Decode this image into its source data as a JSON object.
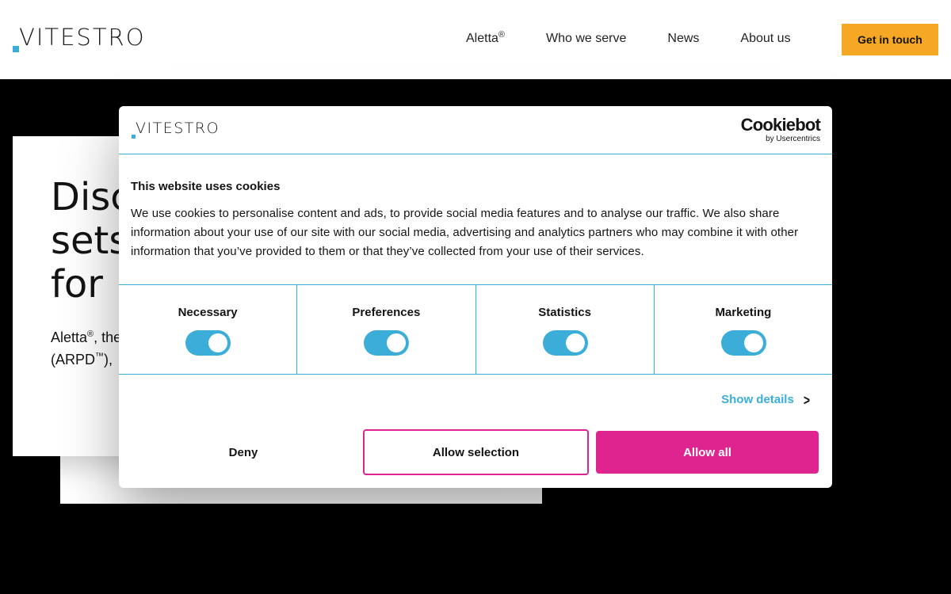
{
  "header": {
    "logo_text": "VITESTRO",
    "nav": {
      "aletta": "Aletta",
      "aletta_mark": "®",
      "who_we_serve": "Who we serve",
      "news": "News",
      "about_us": "About us"
    },
    "cta": "Get in touch"
  },
  "hero": {
    "title_line1": "Disc",
    "title_line2": "sets",
    "title_line3": "for",
    "line1_a": "Aletta",
    "line1_sup": "®",
    "line1_b": ", the",
    "line2_a": "(ARPD",
    "line2_sup": "™",
    "line2_b": "),"
  },
  "cookie": {
    "logo_text": "VITESTRO",
    "brand": "Cookiebot",
    "brand_sub": "by Usercentrics",
    "title": "This website uses cookies",
    "text": "We use cookies to personalise content and ads, to provide social media features and to analyse our traffic. We also share information about your use of our site with our social media, advertising and analytics partners who may combine it with other information that you’ve provided to them or that they’ve collected from your use of their services.",
    "categories": [
      {
        "label": "Necessary",
        "enabled": true
      },
      {
        "label": "Preferences",
        "enabled": true
      },
      {
        "label": "Statistics",
        "enabled": true
      },
      {
        "label": "Marketing",
        "enabled": true
      }
    ],
    "show_details": "Show details",
    "buttons": {
      "deny": "Deny",
      "allow_selection": "Allow selection",
      "allow_all": "Allow all"
    }
  },
  "colors": {
    "accent_blue": "#3aaed8",
    "cta_orange": "#f6a723",
    "allow_pink": "#e0248f"
  }
}
